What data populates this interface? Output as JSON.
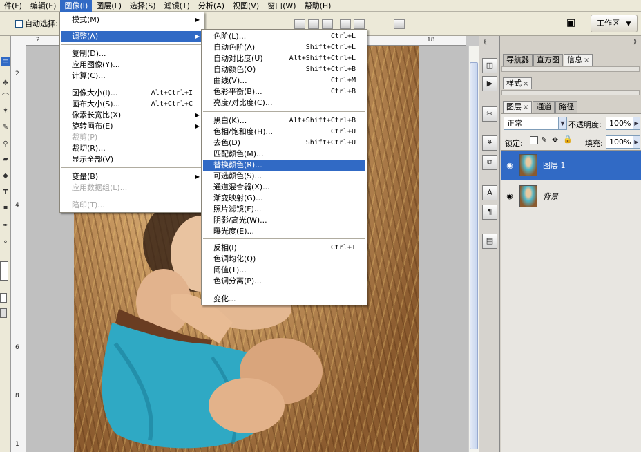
{
  "menubar": [
    {
      "label": "件(F)"
    },
    {
      "label": "编辑(E)"
    },
    {
      "label": "图像(I)",
      "active": true
    },
    {
      "label": "图层(L)"
    },
    {
      "label": "选择(S)"
    },
    {
      "label": "滤镜(T)"
    },
    {
      "label": "分析(A)"
    },
    {
      "label": "视图(V)"
    },
    {
      "label": "窗口(W)"
    },
    {
      "label": "帮助(H)"
    }
  ],
  "options_bar": {
    "auto_select_label": "自动选择:",
    "workspace_label": "工作区"
  },
  "rulers": {
    "top_ticks": [
      "2",
      "18"
    ],
    "left_ticks": [
      "2",
      "4",
      "6",
      "8",
      "1"
    ]
  },
  "image_menu": {
    "items": [
      {
        "label": "模式(M)",
        "submenu": true
      },
      {
        "label": "调整(A)",
        "submenu": true,
        "highlighted": true
      },
      {
        "label": "复制(D)..."
      },
      {
        "label": "应用图像(Y)..."
      },
      {
        "label": "计算(C)..."
      },
      {
        "label": "图像大小(I)...",
        "shortcut": "Alt+Ctrl+I"
      },
      {
        "label": "画布大小(S)...",
        "shortcut": "Alt+Ctrl+C"
      },
      {
        "label": "像素长宽比(X)",
        "submenu": true
      },
      {
        "label": "旋转画布(E)",
        "submenu": true
      },
      {
        "label": "裁剪(P)",
        "disabled": true
      },
      {
        "label": "裁切(R)..."
      },
      {
        "label": "显示全部(V)"
      },
      {
        "label": "变量(B)",
        "submenu": true
      },
      {
        "label": "应用数据组(L)...",
        "disabled": true
      },
      {
        "label": "陷印(T)...",
        "disabled": true
      }
    ]
  },
  "adjust_menu": {
    "items": [
      {
        "label": "色阶(L)...",
        "shortcut": "Ctrl+L"
      },
      {
        "label": "自动色阶(A)",
        "shortcut": "Shift+Ctrl+L"
      },
      {
        "label": "自动对比度(U)",
        "shortcut": "Alt+Shift+Ctrl+L"
      },
      {
        "label": "自动颜色(O)",
        "shortcut": "Shift+Ctrl+B"
      },
      {
        "label": "曲线(V)...",
        "shortcut": "Ctrl+M"
      },
      {
        "label": "色彩平衡(B)...",
        "shortcut": "Ctrl+B"
      },
      {
        "label": "亮度/对比度(C)..."
      },
      {
        "label": "黑白(K)...",
        "shortcut": "Alt+Shift+Ctrl+B"
      },
      {
        "label": "色相/饱和度(H)...",
        "shortcut": "Ctrl+U"
      },
      {
        "label": "去色(D)",
        "shortcut": "Shift+Ctrl+U"
      },
      {
        "label": "匹配颜色(M)..."
      },
      {
        "label": "替换颜色(R)...",
        "highlighted": true
      },
      {
        "label": "可选颜色(S)..."
      },
      {
        "label": "通道混合器(X)..."
      },
      {
        "label": "渐变映射(G)..."
      },
      {
        "label": "照片滤镜(F)..."
      },
      {
        "label": "阴影/高光(W)..."
      },
      {
        "label": "曝光度(E)..."
      },
      {
        "label": "反相(I)",
        "shortcut": "Ctrl+I"
      },
      {
        "label": "色调均化(Q)"
      },
      {
        "label": "阈值(T)..."
      },
      {
        "label": "色调分离(P)..."
      },
      {
        "label": "变化..."
      }
    ]
  },
  "panels": {
    "group1_tabs": [
      "导航器",
      "直方图",
      "信息"
    ],
    "group2_tabs": [
      "样式"
    ],
    "group3_tabs": [
      "图层",
      "通道",
      "路径"
    ],
    "blend_mode": "正常",
    "opacity_label": "不透明度:",
    "opacity_value": "100%",
    "lock_label": "锁定:",
    "fill_label": "填充:",
    "fill_value": "100%",
    "layers": [
      {
        "name": "图层 1",
        "selected": true
      },
      {
        "name": "背景",
        "selected": false
      }
    ]
  }
}
